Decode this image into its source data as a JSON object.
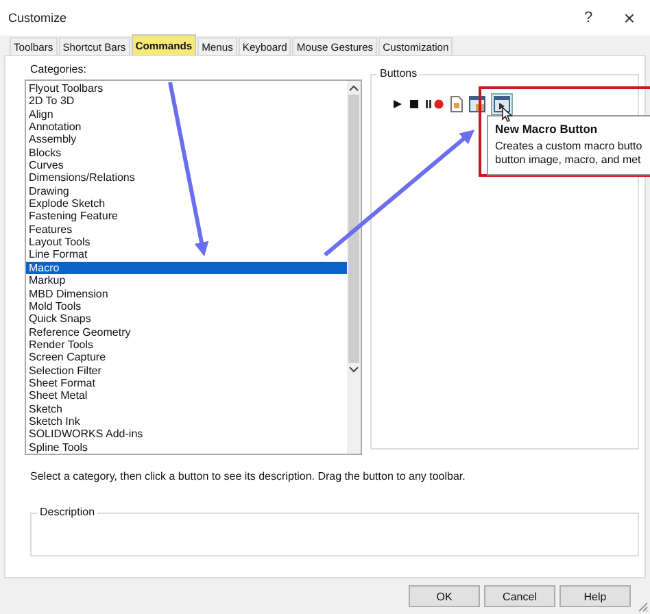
{
  "window": {
    "title": "Customize",
    "help": "?",
    "close": "×"
  },
  "tabs": [
    {
      "label": "Toolbars",
      "selected": false
    },
    {
      "label": "Shortcut Bars",
      "selected": false
    },
    {
      "label": "Commands",
      "selected": true
    },
    {
      "label": "Menus",
      "selected": false
    },
    {
      "label": "Keyboard",
      "selected": false
    },
    {
      "label": "Mouse Gestures",
      "selected": false
    },
    {
      "label": "Customization",
      "selected": false
    }
  ],
  "categories": {
    "label": "Categories:",
    "items": [
      {
        "label": "Flyout Toolbars",
        "selected": false
      },
      {
        "label": "2D To 3D",
        "selected": false
      },
      {
        "label": "Align",
        "selected": false
      },
      {
        "label": "Annotation",
        "selected": false
      },
      {
        "label": "Assembly",
        "selected": false
      },
      {
        "label": "Blocks",
        "selected": false
      },
      {
        "label": "Curves",
        "selected": false
      },
      {
        "label": "Dimensions/Relations",
        "selected": false
      },
      {
        "label": "Drawing",
        "selected": false
      },
      {
        "label": "Explode Sketch",
        "selected": false
      },
      {
        "label": "Fastening Feature",
        "selected": false
      },
      {
        "label": "Features",
        "selected": false
      },
      {
        "label": "Layout Tools",
        "selected": false
      },
      {
        "label": "Line Format",
        "selected": false
      },
      {
        "label": "Macro",
        "selected": true
      },
      {
        "label": "Markup",
        "selected": false
      },
      {
        "label": "MBD Dimension",
        "selected": false
      },
      {
        "label": "Mold Tools",
        "selected": false
      },
      {
        "label": "Quick Snaps",
        "selected": false
      },
      {
        "label": "Reference Geometry",
        "selected": false
      },
      {
        "label": "Render Tools",
        "selected": false
      },
      {
        "label": "Screen Capture",
        "selected": false
      },
      {
        "label": "Selection Filter",
        "selected": false
      },
      {
        "label": "Sheet Format",
        "selected": false
      },
      {
        "label": "Sheet Metal",
        "selected": false
      },
      {
        "label": "Sketch",
        "selected": false
      },
      {
        "label": "Sketch Ink",
        "selected": false
      },
      {
        "label": "SOLIDWORKS Add-ins",
        "selected": false
      },
      {
        "label": "Spline Tools",
        "selected": false
      }
    ]
  },
  "buttons_group": {
    "label": "Buttons"
  },
  "tooltip": {
    "title": "New Macro Button",
    "lines": [
      "Creates a custom macro butto",
      "button image, macro, and met"
    ]
  },
  "hint": "Select a category, then click a button to see its description. Drag the button to any toolbar.",
  "description": {
    "label": "Description"
  },
  "dialog_buttons": [
    "OK",
    "Cancel",
    "Help"
  ]
}
